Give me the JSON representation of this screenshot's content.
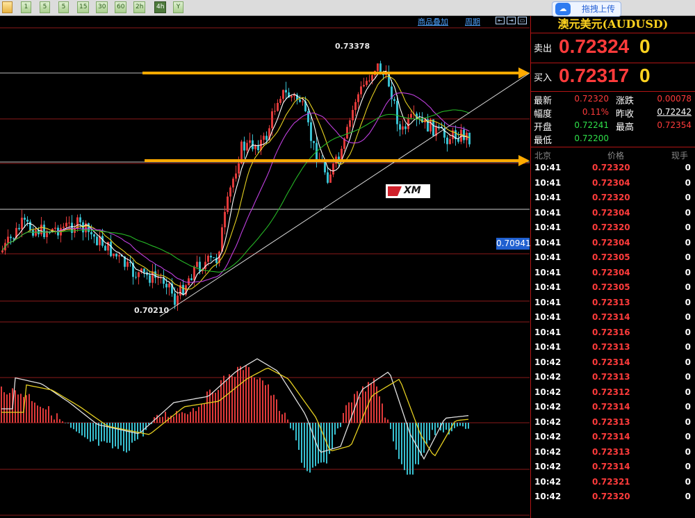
{
  "toolbar": {
    "buttons": [
      "",
      "1",
      "5",
      "5",
      "15",
      "30",
      "60",
      "2h",
      "4h",
      "Y"
    ]
  },
  "upload": {
    "label": "拖拽上传"
  },
  "chart_header": {
    "overlay": "商品叠加",
    "period": "周期"
  },
  "chart": {
    "high_label": "0.73378",
    "low_label": "0.70210",
    "price_tag": "0.70941",
    "watermark": "XM",
    "colors": {
      "up": "#e03a3a",
      "down": "#38c0d0",
      "support": "#ffaa00",
      "grid": "#8b1a1a",
      "ma_fast": "#ffffff",
      "ma_slow": "#e6d020",
      "ma_mid": "#c040e0",
      "ma_long": "#26b826"
    }
  },
  "symbol": {
    "title": "澳元美元(AUDUSD)"
  },
  "quotes": {
    "sell_label": "卖出",
    "sell_price": "0.72324",
    "sell_vol": "0",
    "buy_label": "买入",
    "buy_price": "0.72317",
    "buy_vol": "0"
  },
  "stats": {
    "latest_label": "最新",
    "latest": "0.72320",
    "change_label": "涨跌",
    "change": "0.00078",
    "range_label": "幅度",
    "range": "0.11%",
    "prev_label": "昨收",
    "prev": "0.72242",
    "open_label": "开盘",
    "open": "0.72241",
    "high_label": "最高",
    "high": "0.72354",
    "low_label": "最低",
    "low": "0.72200"
  },
  "ticks_header": {
    "time": "北京",
    "price": "价格",
    "vol": "现手"
  },
  "ticks": [
    {
      "time": "10:41",
      "price": "0.72320",
      "vol": "0"
    },
    {
      "time": "10:41",
      "price": "0.72304",
      "vol": "0"
    },
    {
      "time": "10:41",
      "price": "0.72320",
      "vol": "0"
    },
    {
      "time": "10:41",
      "price": "0.72304",
      "vol": "0"
    },
    {
      "time": "10:41",
      "price": "0.72320",
      "vol": "0"
    },
    {
      "time": "10:41",
      "price": "0.72304",
      "vol": "0"
    },
    {
      "time": "10:41",
      "price": "0.72305",
      "vol": "0"
    },
    {
      "time": "10:41",
      "price": "0.72304",
      "vol": "0"
    },
    {
      "time": "10:41",
      "price": "0.72305",
      "vol": "0"
    },
    {
      "time": "10:41",
      "price": "0.72313",
      "vol": "0"
    },
    {
      "time": "10:41",
      "price": "0.72314",
      "vol": "0"
    },
    {
      "time": "10:41",
      "price": "0.72316",
      "vol": "0"
    },
    {
      "time": "10:41",
      "price": "0.72313",
      "vol": "0"
    },
    {
      "time": "10:42",
      "price": "0.72314",
      "vol": "0"
    },
    {
      "time": "10:42",
      "price": "0.72313",
      "vol": "0"
    },
    {
      "time": "10:42",
      "price": "0.72312",
      "vol": "0"
    },
    {
      "time": "10:42",
      "price": "0.72314",
      "vol": "0"
    },
    {
      "time": "10:42",
      "price": "0.72313",
      "vol": "0"
    },
    {
      "time": "10:42",
      "price": "0.72314",
      "vol": "0"
    },
    {
      "time": "10:42",
      "price": "0.72313",
      "vol": "0"
    },
    {
      "time": "10:42",
      "price": "0.72314",
      "vol": "0"
    },
    {
      "time": "10:42",
      "price": "0.72321",
      "vol": "0"
    },
    {
      "time": "10:42",
      "price": "0.72320",
      "vol": "0"
    }
  ]
}
